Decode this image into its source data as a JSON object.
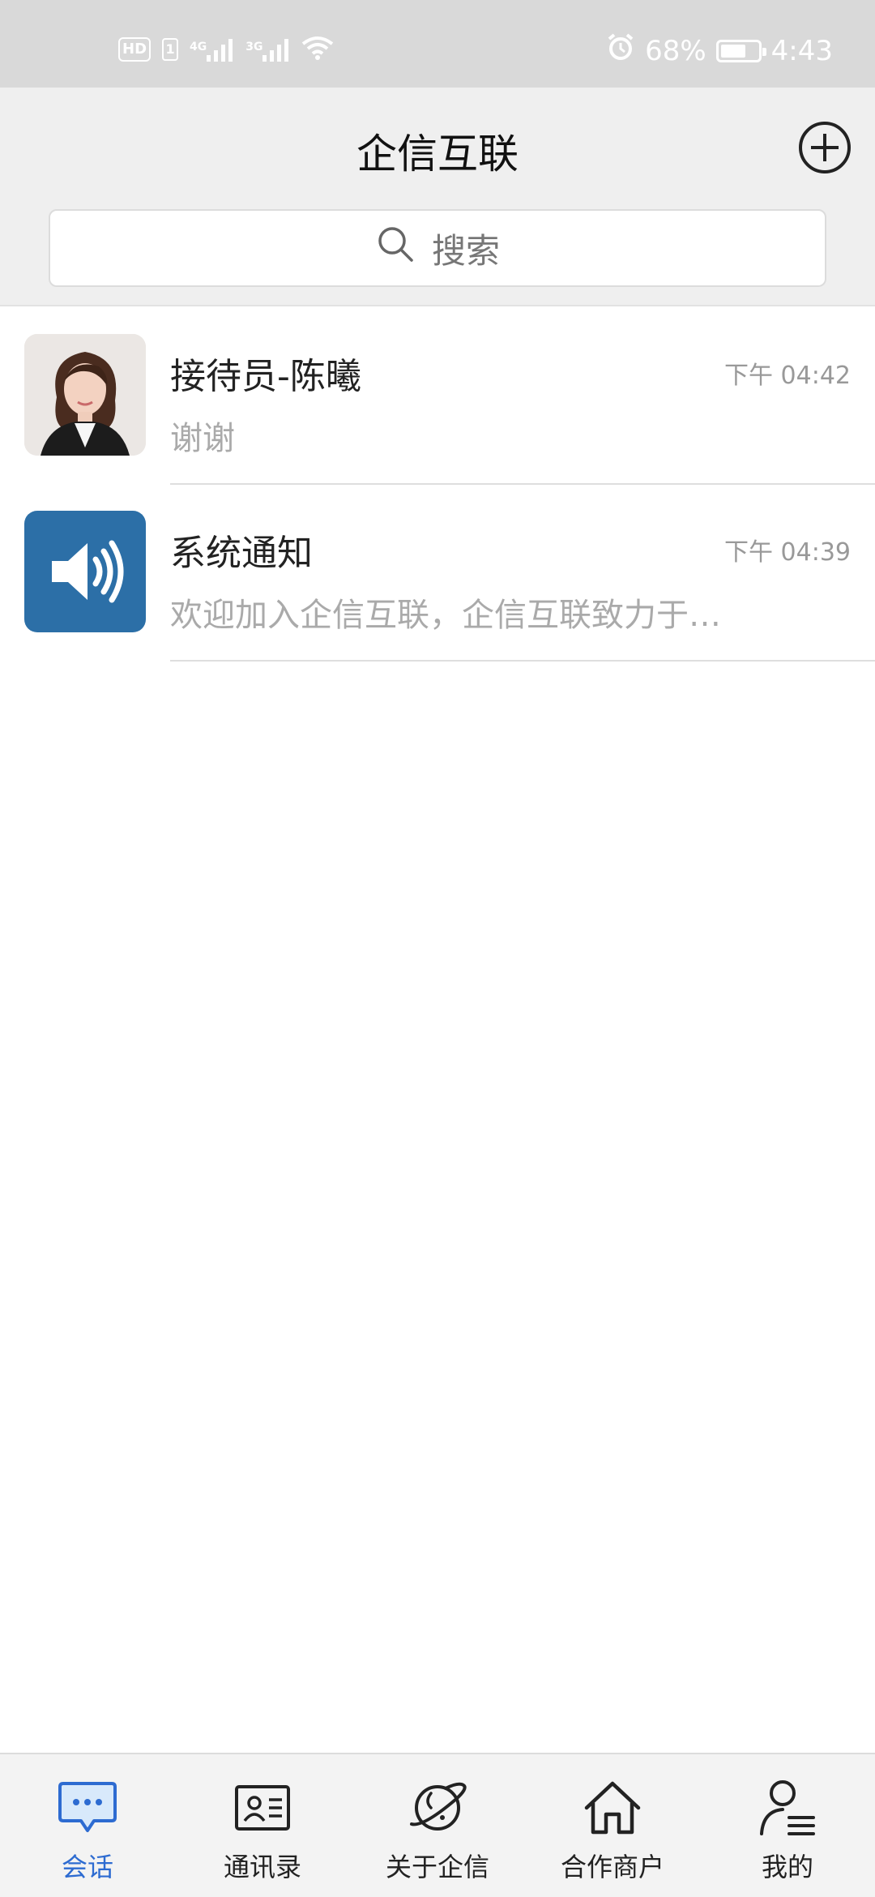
{
  "status_bar": {
    "hd": "HD",
    "sim": "1",
    "net1": "4G",
    "net2": "3G",
    "battery_pct": "68%",
    "battery_level": 0.68,
    "time": "4:43"
  },
  "header": {
    "title": "企信互联"
  },
  "search": {
    "placeholder": "搜索"
  },
  "conversations": [
    {
      "name": "接待员-陈曦",
      "time": "下午 04:42",
      "preview": "谢谢",
      "avatar": "person-photo"
    },
    {
      "name": "系统通知",
      "time": "下午 04:39",
      "preview": "欢迎加入企信互联，企信互联致力于…",
      "avatar": "speaker-icon"
    }
  ],
  "tabs": [
    {
      "label": "会话",
      "icon": "chat-bubble-icon",
      "active": true
    },
    {
      "label": "通讯录",
      "icon": "contact-card-icon",
      "active": false
    },
    {
      "label": "关于企信",
      "icon": "planet-icon",
      "active": false
    },
    {
      "label": "合作商户",
      "icon": "home-icon",
      "active": false
    },
    {
      "label": "我的",
      "icon": "user-list-icon",
      "active": false
    }
  ],
  "colors": {
    "accent": "#2d6bd1",
    "system_avatar_bg": "#2c6fa7",
    "header_bg": "#efefef",
    "status_bar_bg": "#d9d9d9"
  }
}
